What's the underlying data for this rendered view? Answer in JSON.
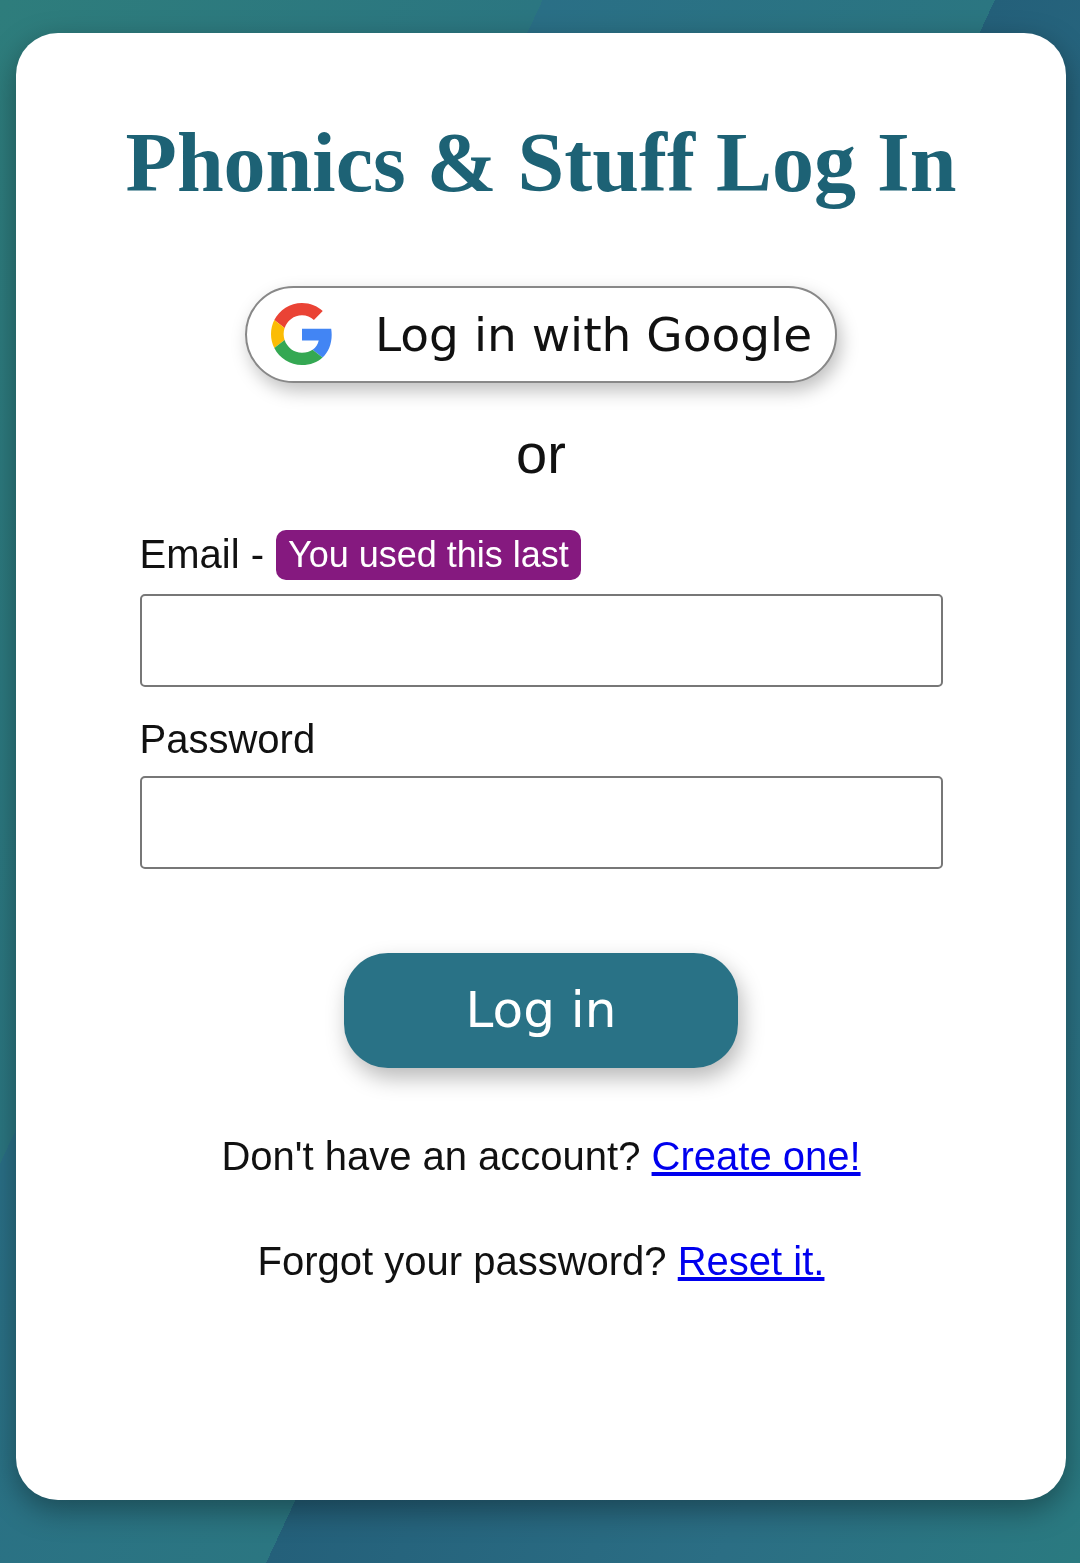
{
  "title": "Phonics & Stuff Log In",
  "google_button": {
    "label": "Log in with Google"
  },
  "separator": "or",
  "fields": [
    {
      "label": "Email -",
      "badge": "You used this last"
    },
    {
      "label": "Password"
    }
  ],
  "login_button": {
    "label": "Log in"
  },
  "links": [
    {
      "text": "Don't have an account?",
      "link": "Create one!"
    },
    {
      "text": "Forgot your password?",
      "link": "Reset it."
    }
  ]
}
